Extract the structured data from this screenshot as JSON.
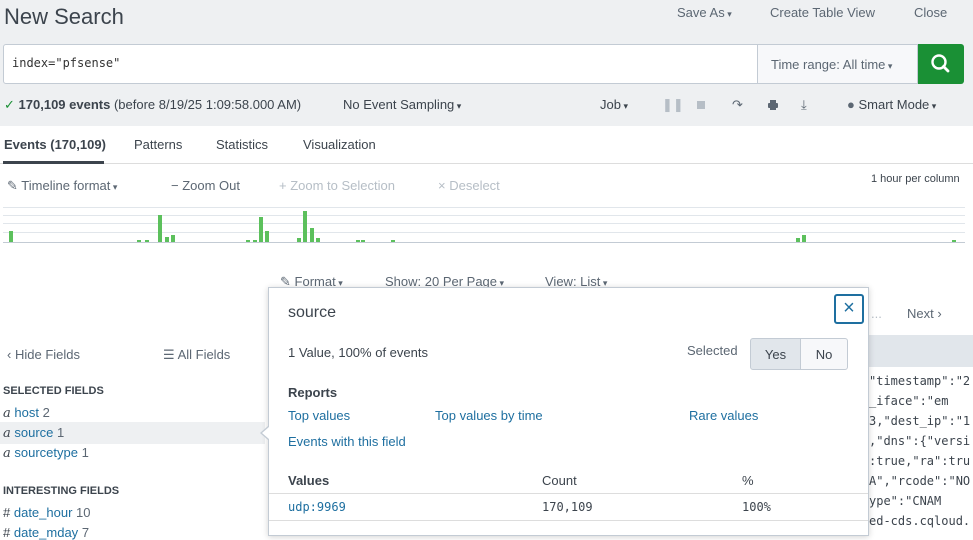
{
  "header": {
    "title": "New Search",
    "save_as": "Save As",
    "create_table_view": "Create Table View",
    "close": "Close"
  },
  "search": {
    "query": "index=\"pfsense\"",
    "time_range": "Time range: All time"
  },
  "status": {
    "event_count": "170,109 events",
    "before": "(before 8/19/25 1:09:58.000 AM)",
    "sampling": "No Event Sampling",
    "job": "Job",
    "mode": "Smart Mode"
  },
  "tabs": [
    "Events (170,109)",
    "Patterns",
    "Statistics",
    "Visualization"
  ],
  "timeline": {
    "format": "Timeline format",
    "zoom_out": "Zoom Out",
    "zoom_selection": "Zoom to Selection",
    "deselect": "Deselect",
    "scale": "1 hour per column",
    "bars": [
      0.3,
      0.05,
      0.05,
      0.75,
      0.15,
      0.2,
      0.05,
      0.05,
      0.7,
      0.3,
      0.1,
      0.85,
      0.4,
      0.1,
      0.05,
      0.05,
      0.05,
      0.1,
      0.2,
      0.05
    ]
  },
  "results_bar": {
    "format": "Format",
    "per_page": "Show: 20 Per Page",
    "view": "View: List",
    "next": "Next",
    "ellipsis": "..."
  },
  "sidebar": {
    "hide_fields": "Hide Fields",
    "all_fields": "All Fields",
    "selected_title": "SELECTED FIELDS",
    "selected": [
      {
        "type": "a",
        "name": "host",
        "count": "2"
      },
      {
        "type": "a",
        "name": "source",
        "count": "1"
      },
      {
        "type": "a",
        "name": "sourcetype",
        "count": "1"
      }
    ],
    "interesting_title": "INTERESTING FIELDS",
    "interesting": [
      {
        "type": "#",
        "name": "date_hour",
        "count": "10"
      },
      {
        "type": "#",
        "name": "date_mday",
        "count": "7"
      }
    ]
  },
  "popup": {
    "title": "source",
    "summary": "1 Value, 100% of events",
    "selected_label": "Selected",
    "yes": "Yes",
    "no": "No",
    "reports_title": "Reports",
    "reports": [
      "Top values",
      "Top values by time",
      "Rare values",
      "Events with this field"
    ],
    "columns": [
      "Values",
      "Count",
      "%"
    ],
    "rows": [
      {
        "value": "udp:9969",
        "count": "170,109",
        "pct": "100%"
      }
    ]
  },
  "events_text": [
    "\"timestamp\":\"2",
    "_iface\":\"em",
    "3,\"dest_ip\":\"1",
    ",\"dns\":{\"versi",
    ":true,\"ra\":tru",
    "A\",\"rcode\":\"NO",
    "ype\":\"CNAM",
    "ed-cds.cqloud."
  ],
  "colors": {
    "accent_green": "#1a9035",
    "link": "#1e6fa0",
    "bar": "#5cc05c",
    "popup_border": "#1e6fa0"
  }
}
